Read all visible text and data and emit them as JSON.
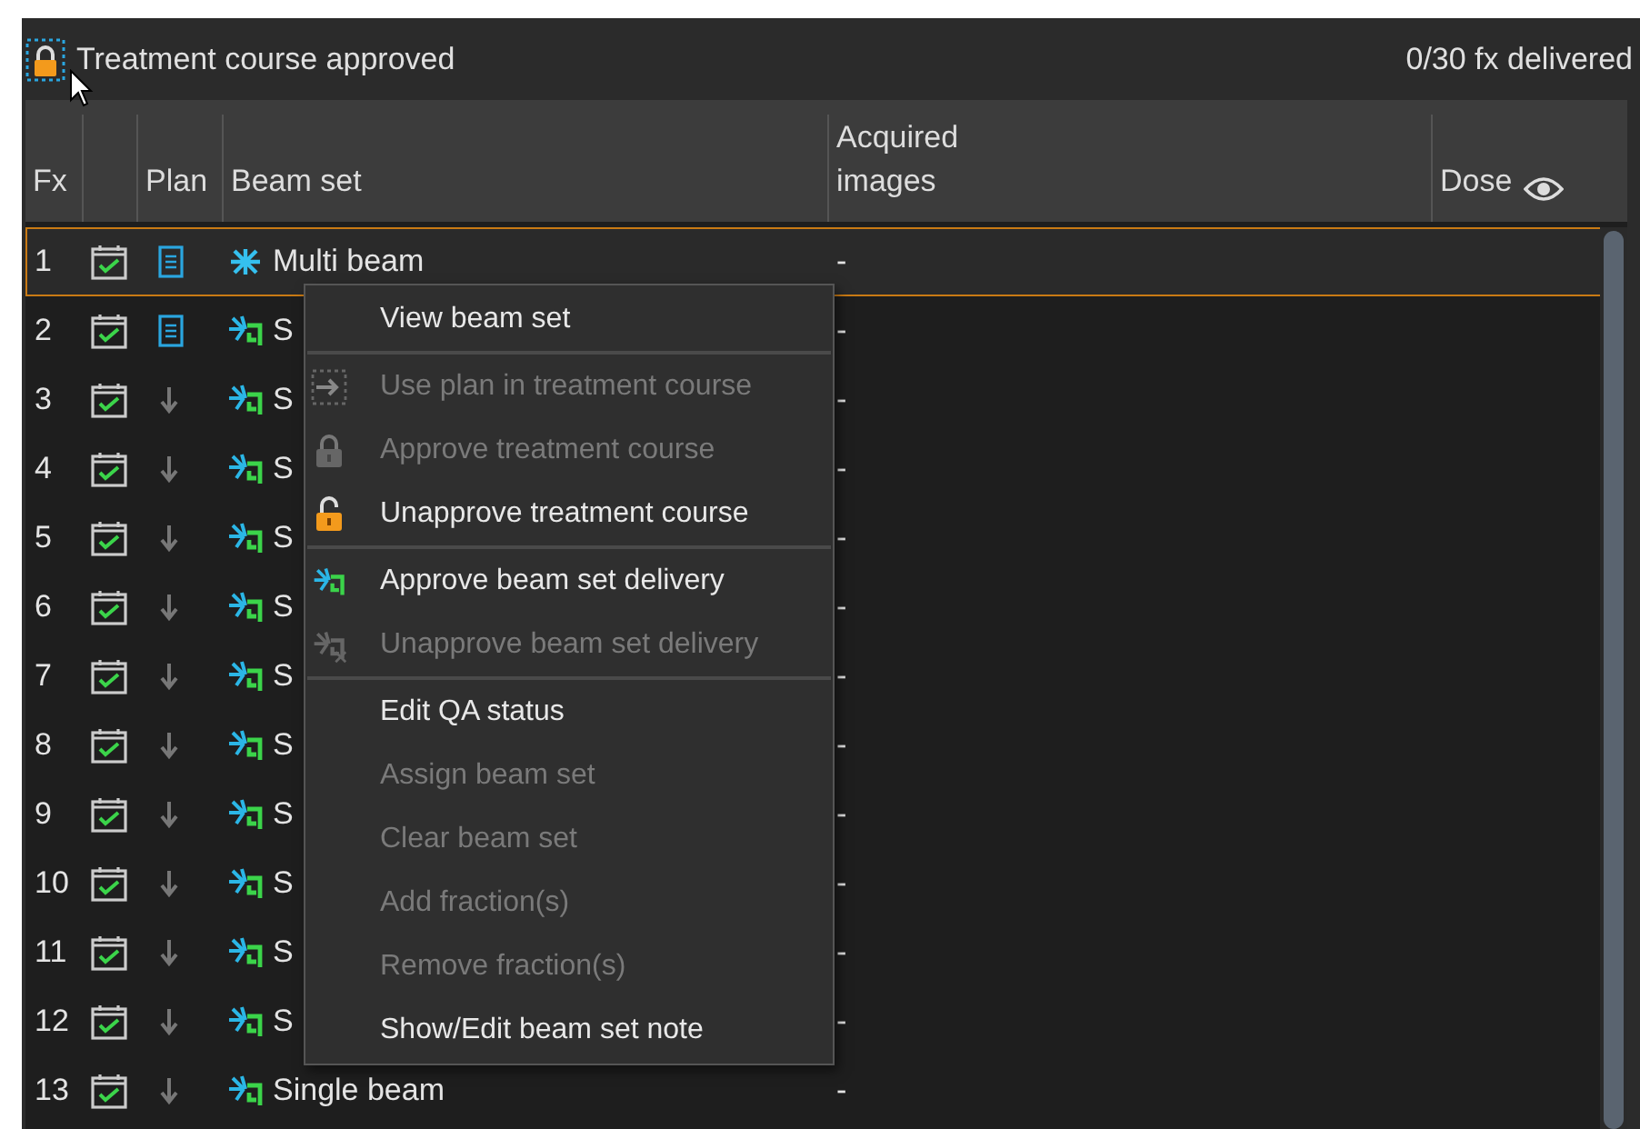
{
  "header": {
    "title": "Treatment course approved",
    "status": "0/30 fx delivered"
  },
  "table": {
    "columns": [
      "Fx",
      "Plan",
      "Beam set",
      "Acquired images",
      "Dose"
    ],
    "rows": [
      {
        "fx": "1",
        "has_plan": true,
        "kind": "multi",
        "beam_set": "Multi beam",
        "acquired": "-",
        "selected": true
      },
      {
        "fx": "2",
        "has_plan": true,
        "kind": "single",
        "beam_set": "S",
        "acquired": "-",
        "selected": false
      },
      {
        "fx": "3",
        "has_plan": false,
        "kind": "single",
        "beam_set": "S",
        "acquired": "-",
        "selected": false
      },
      {
        "fx": "4",
        "has_plan": false,
        "kind": "single",
        "beam_set": "S",
        "acquired": "-",
        "selected": false
      },
      {
        "fx": "5",
        "has_plan": false,
        "kind": "single",
        "beam_set": "S",
        "acquired": "-",
        "selected": false
      },
      {
        "fx": "6",
        "has_plan": false,
        "kind": "single",
        "beam_set": "S",
        "acquired": "-",
        "selected": false
      },
      {
        "fx": "7",
        "has_plan": false,
        "kind": "single",
        "beam_set": "S",
        "acquired": "-",
        "selected": false
      },
      {
        "fx": "8",
        "has_plan": false,
        "kind": "single",
        "beam_set": "S",
        "acquired": "-",
        "selected": false
      },
      {
        "fx": "9",
        "has_plan": false,
        "kind": "single",
        "beam_set": "S",
        "acquired": "-",
        "selected": false
      },
      {
        "fx": "10",
        "has_plan": false,
        "kind": "single",
        "beam_set": "S",
        "acquired": "-",
        "selected": false
      },
      {
        "fx": "11",
        "has_plan": false,
        "kind": "single",
        "beam_set": "S",
        "acquired": "-",
        "selected": false
      },
      {
        "fx": "12",
        "has_plan": false,
        "kind": "single",
        "beam_set": "S",
        "acquired": "-",
        "selected": false
      },
      {
        "fx": "13",
        "has_plan": false,
        "kind": "single",
        "beam_set": "Single beam",
        "acquired": "-",
        "selected": false
      }
    ]
  },
  "context_menu": {
    "groups": [
      [
        {
          "label": "View beam set",
          "disabled": false,
          "kind": "plain"
        }
      ],
      [
        {
          "label": "Use plan in treatment course",
          "disabled": true,
          "kind": "use-plan"
        },
        {
          "label": "Approve treatment course",
          "disabled": true,
          "kind": "lock"
        },
        {
          "label": "Unapprove treatment course",
          "disabled": false,
          "kind": "unlock"
        }
      ],
      [
        {
          "label": "Approve beam set delivery",
          "disabled": false,
          "kind": "beam"
        },
        {
          "label": "Unapprove beam set delivery",
          "disabled": true,
          "kind": "beam-x"
        }
      ],
      [
        {
          "label": "Edit QA status",
          "disabled": false,
          "kind": "plain"
        },
        {
          "label": "Assign beam set",
          "disabled": true,
          "kind": "plain"
        },
        {
          "label": "Clear beam set",
          "disabled": true,
          "kind": "plain"
        },
        {
          "label": "Add fraction(s)",
          "disabled": true,
          "kind": "plain"
        },
        {
          "label": "Remove fraction(s)",
          "disabled": true,
          "kind": "plain"
        },
        {
          "label": "Show/Edit beam set note",
          "disabled": false,
          "kind": "plain"
        }
      ]
    ]
  }
}
